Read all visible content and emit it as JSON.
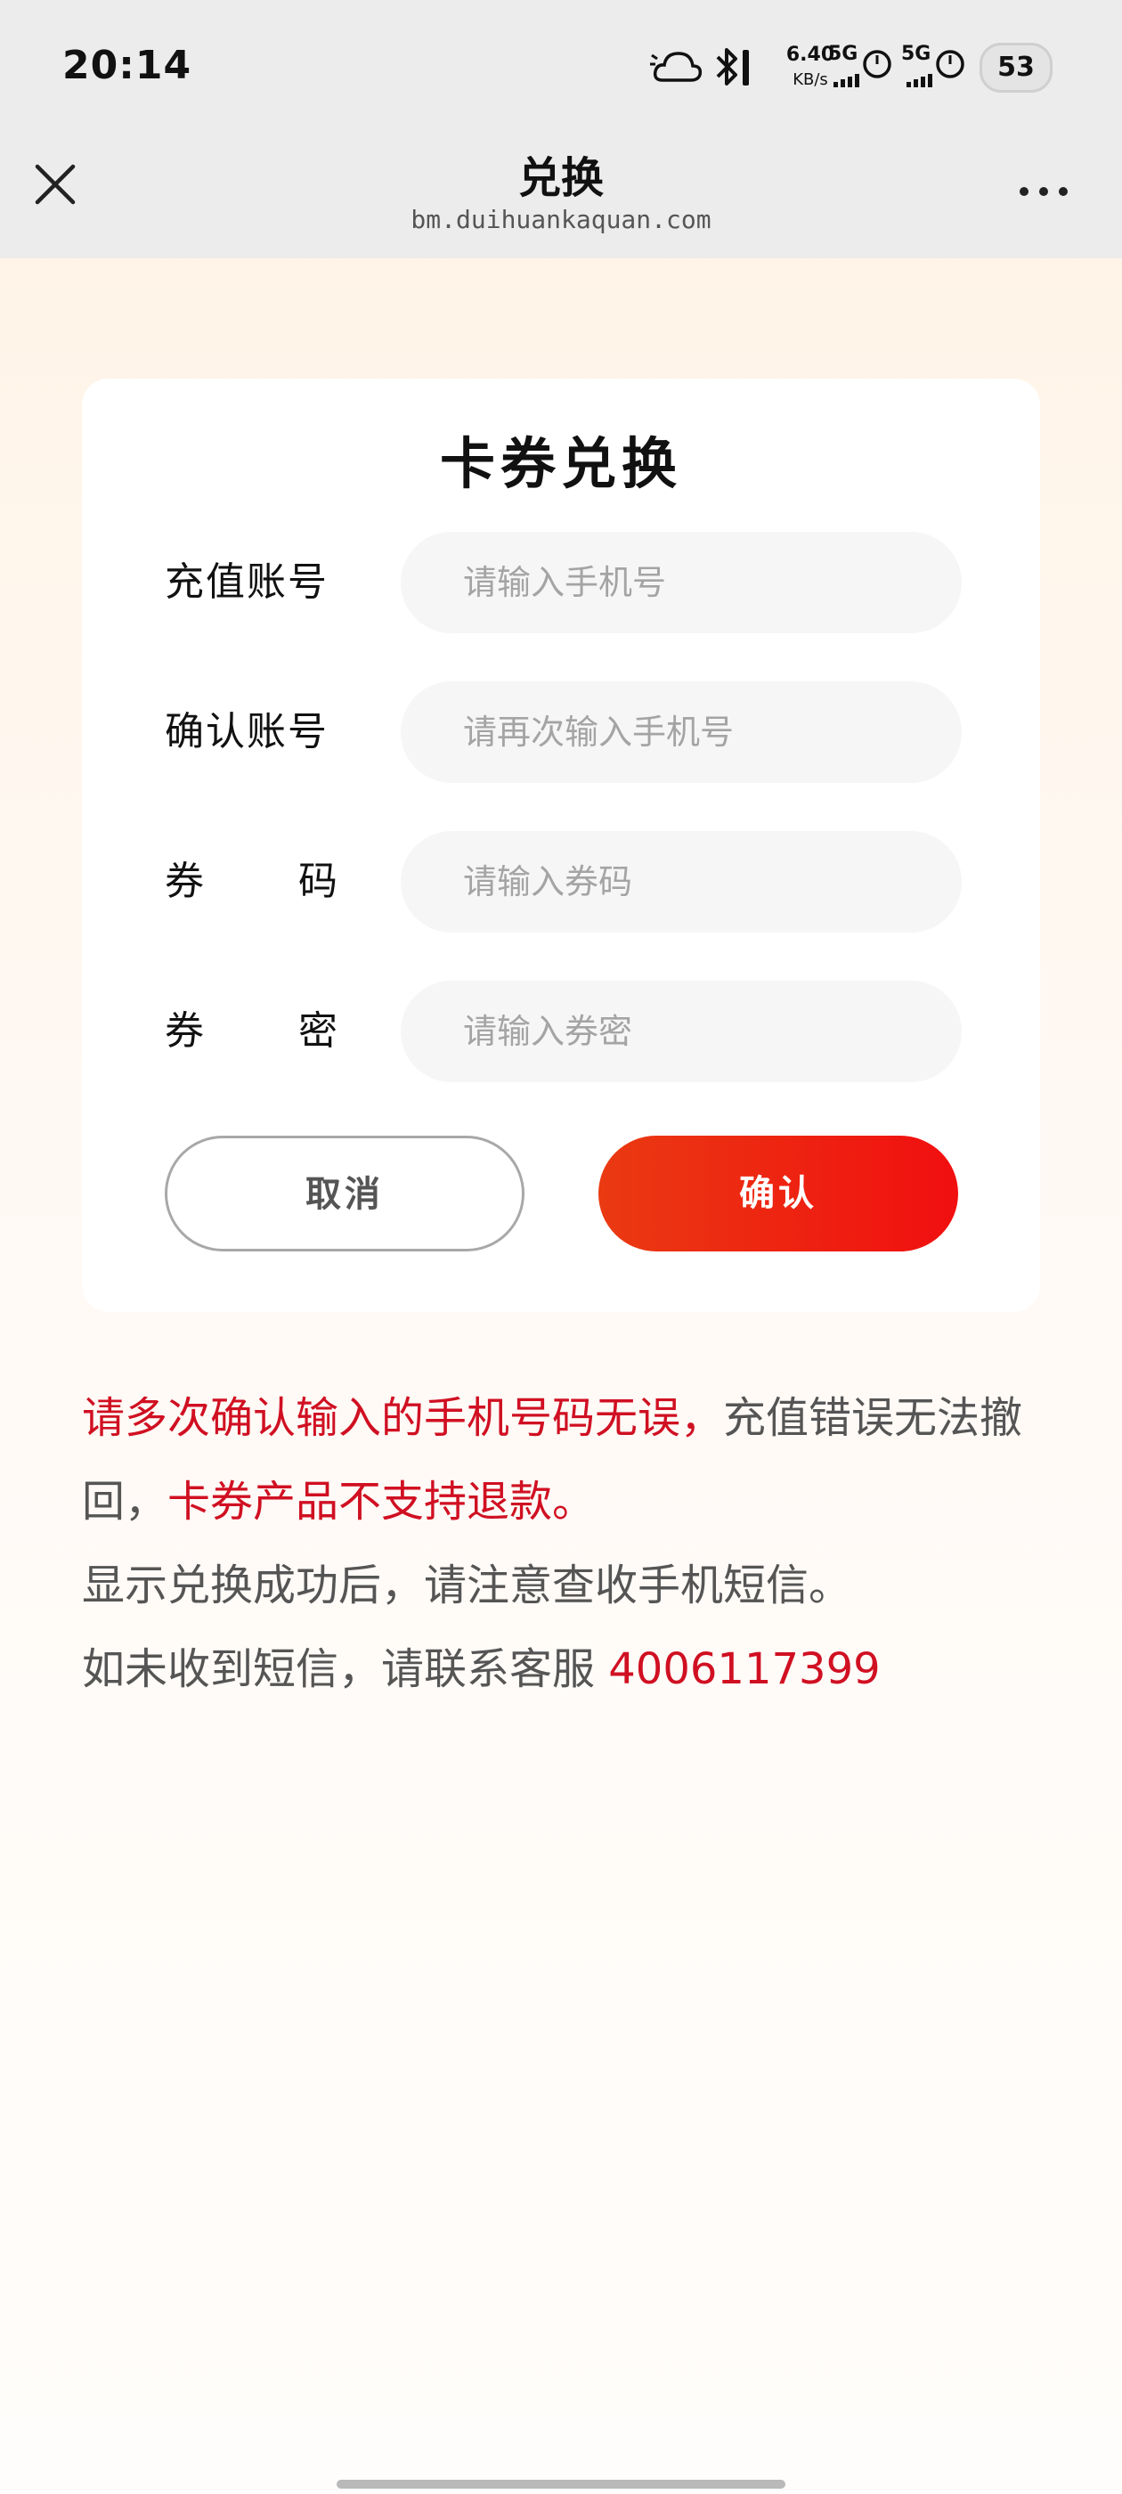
{
  "status_bar": {
    "time": "20:14",
    "net_speed_value": "6.40",
    "net_speed_unit": "KB/s",
    "signal1_label": "5G",
    "signal2_label": "5G",
    "battery_level": "53",
    "icons": [
      "cloud-icon",
      "bluetooth-icon",
      "signal-icon",
      "battery-icon"
    ]
  },
  "titlebar": {
    "title": "兑换",
    "url": "bm.duihuankaquan.com",
    "icons": [
      "close-icon",
      "more-icon"
    ]
  },
  "form": {
    "title": "卡券兑换",
    "fields": [
      {
        "label": "充值账号",
        "placeholder": "请输入手机号",
        "value": ""
      },
      {
        "label": "确认账号",
        "placeholder": "请再次输入手机号",
        "value": ""
      },
      {
        "label_chars": [
          "券",
          "码"
        ],
        "placeholder": "请输入券码",
        "value": ""
      },
      {
        "label_chars": [
          "券",
          "密"
        ],
        "placeholder": "请输入券密",
        "value": ""
      }
    ],
    "cancel_label": "取消",
    "confirm_label": "确认"
  },
  "notice": {
    "line1_red": "请多次确认输入的手机号码无误，",
    "line1_grey": "充值错误无法撤回，",
    "line2_red": "卡券产品不支持退款。",
    "line3": "显示兑换成功后，请注意查收手机短信。",
    "line4": "如未收到短信，请联系客服 ",
    "phone": "4006117399"
  },
  "colors": {
    "accent": "#f10f10",
    "accent_start": "#ea3a12",
    "warning_text": "#d01022",
    "bar_bg": "#ececec"
  }
}
